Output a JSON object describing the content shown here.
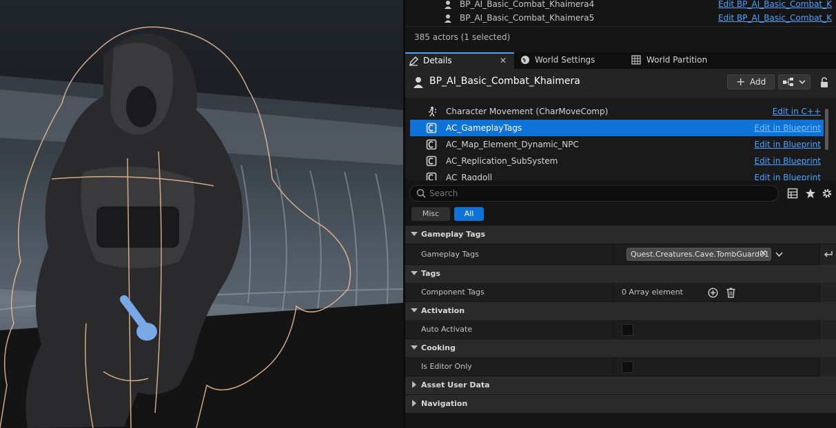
{
  "outliner": {
    "rows": [
      {
        "name": "BP_AI_Basic_Combat_Khaimera4",
        "link": "Edit BP_AI_Basic_Combat_K"
      },
      {
        "name": "BP_AI_Basic_Combat_Khaimera5",
        "link": "Edit BP_AI_Basic_Combat_K"
      }
    ],
    "actor_count": "385 actors (1 selected)"
  },
  "tabs": {
    "details": "Details",
    "world_settings": "World Settings",
    "world_partition": "World Partition"
  },
  "header": {
    "actor_name": "BP_AI_Basic_Combat_Khaimera",
    "add_label": "Add"
  },
  "components": [
    {
      "name": "Character Movement (CharMoveComp)",
      "link": "Edit in C++",
      "icon": "movement-icon"
    },
    {
      "name": "AC_GameplayTags",
      "link": "Edit in Blueprint",
      "icon": "component-icon",
      "selected": true
    },
    {
      "name": "AC_Map_Element_Dynamic_NPC",
      "link": "Edit in Blueprint",
      "icon": "component-icon"
    },
    {
      "name": "AC_Replication_SubSystem",
      "link": "Edit in Blueprint",
      "icon": "component-icon"
    },
    {
      "name": "AC_Ragdoll",
      "link": "Edit in Blueprint",
      "icon": "component-icon"
    }
  ],
  "search": {
    "placeholder": "Search"
  },
  "filters": {
    "misc": "Misc",
    "all": "All"
  },
  "categories": {
    "gameplay_tags": "Gameplay Tags",
    "tags": "Tags",
    "activation": "Activation",
    "cooking": "Cooking",
    "asset_user_data": "Asset User Data",
    "navigation": "Navigation"
  },
  "properties": {
    "gameplay_tags_label": "Gameplay Tags",
    "gameplay_tag_value": "Quest.Creatures.Cave.TombGuard01",
    "component_tags_label": "Component Tags",
    "component_tags_value": "0 Array element",
    "auto_activate_label": "Auto Activate",
    "auto_activate_checked": false,
    "is_editor_only_label": "Is Editor Only",
    "is_editor_only_checked": false
  },
  "colors": {
    "accent": "#0e72d6",
    "link": "#4fa3ff",
    "selection_outline": "#e8b894"
  }
}
